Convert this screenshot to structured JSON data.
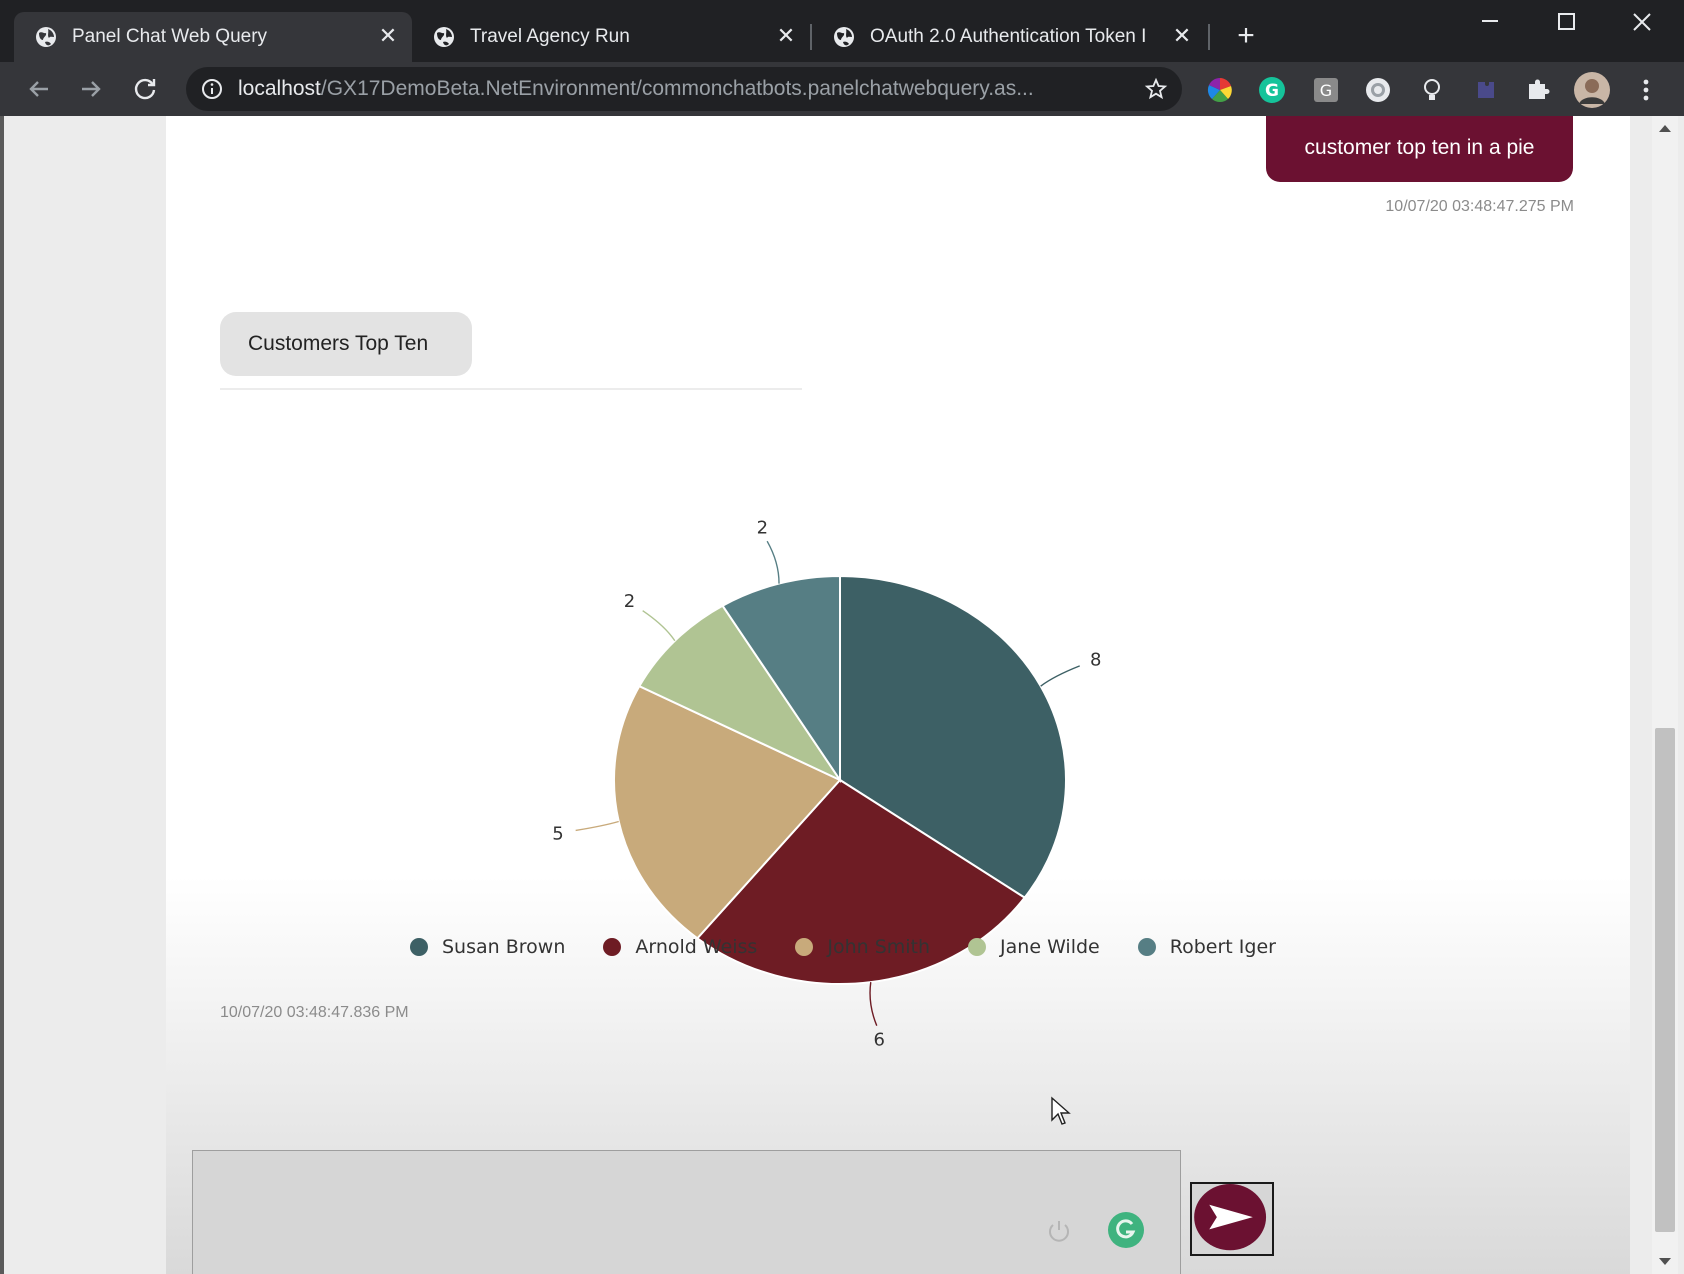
{
  "browser": {
    "tabs": [
      {
        "title": "Panel Chat Web Query",
        "active": true
      },
      {
        "title": "Travel Agency Run",
        "active": false
      },
      {
        "title": "OAuth 2.0 Authentication Token I",
        "active": false
      }
    ],
    "new_tab_label": "+",
    "url_host": "localhost",
    "url_path": "/GX17DemoBeta.NetEnvironment/commonchatbots.panelchatwebquery.as...",
    "extensions": [
      "color-wheel-icon",
      "grammarly-icon",
      "g-extension-icon",
      "circle-extension-icon",
      "bulb-icon",
      "puzzle-piece-dim-icon",
      "extensions-puzzle-icon"
    ]
  },
  "chat": {
    "user_message": "customer top ten in a pie",
    "user_timestamp": "10/07/20 03:48:47.275 PM",
    "bot_message": "Customers Top Ten",
    "bot_timestamp": "10/07/20 03:48:47.836 PM",
    "input_value": "",
    "user_bubble_color": "#6b1131"
  },
  "chart_data": {
    "type": "pie",
    "title": "",
    "slices": [
      {
        "label": "Susan Brown",
        "value": 8,
        "color": "#3d6065"
      },
      {
        "label": "Arnold Weiss",
        "value": 6,
        "color": "#6e1c24"
      },
      {
        "label": "John Smith",
        "value": 5,
        "color": "#c8aa7b"
      },
      {
        "label": "Jane Wilde",
        "value": 2,
        "color": "#b0c493"
      },
      {
        "label": "Robert Iger",
        "value": 2,
        "color": "#567e84"
      }
    ],
    "data_labels": true,
    "legend_position": "bottom"
  }
}
